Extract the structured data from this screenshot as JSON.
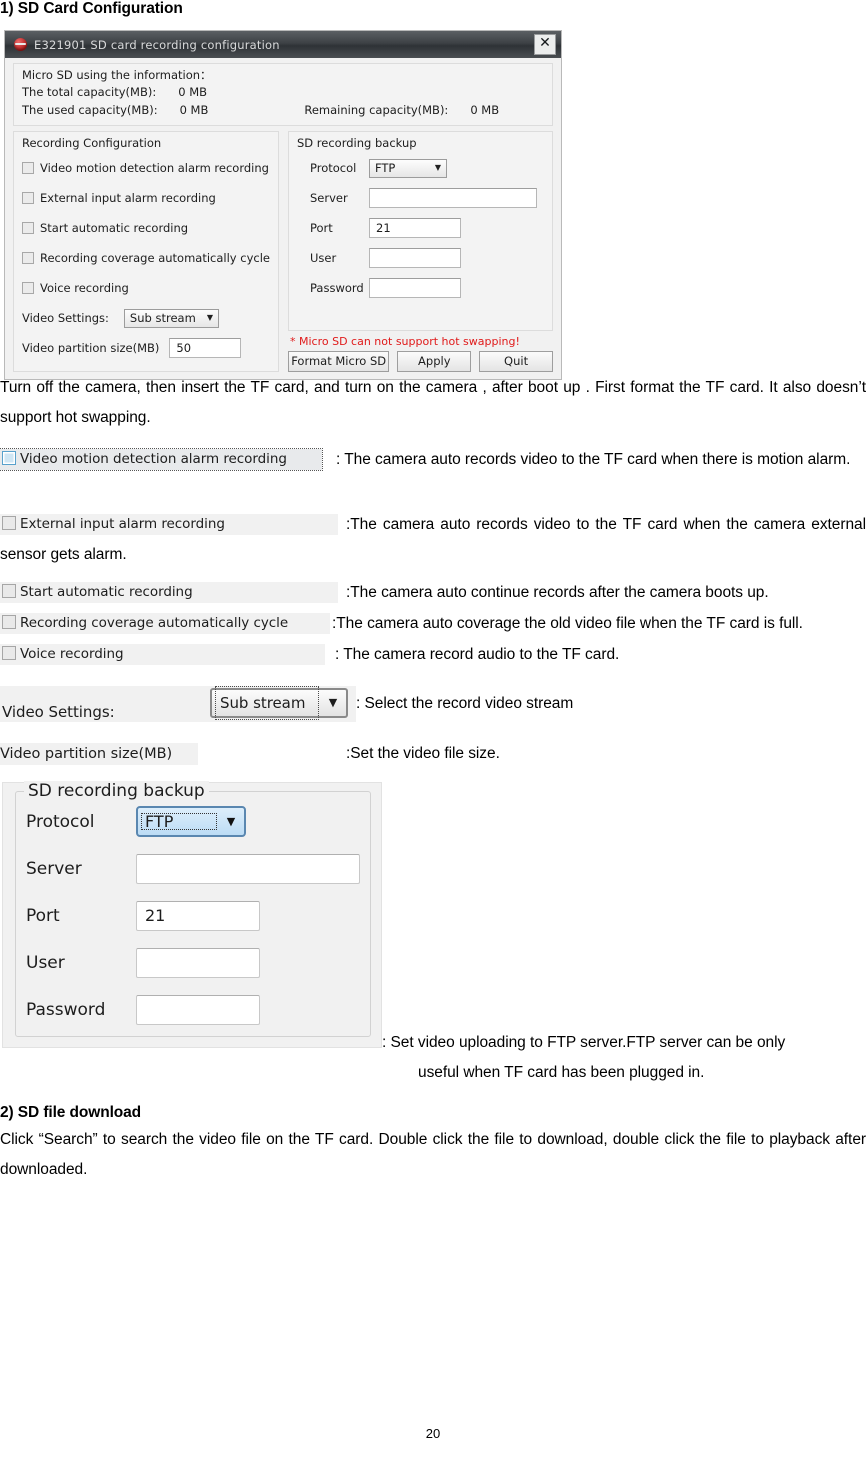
{
  "heading1": "1) SD Card Configuration",
  "dialog": {
    "title": "E321901 SD card recording configuration",
    "close_label": "✕",
    "logo_icon": "red-disc-icon",
    "info": {
      "header": "Micro SD using the information：",
      "total_label": "The total capacity(MB):",
      "total_value": "0 MB",
      "used_label": "The used capacity(MB):",
      "used_value": "0 MB",
      "remaining_label": "Remaining capacity(MB):",
      "remaining_value": "0 MB"
    },
    "recording_group": {
      "title": "Recording Configuration",
      "checkboxes": [
        {
          "label": "Video motion detection alarm recording",
          "checked": false
        },
        {
          "label": "External input alarm recording",
          "checked": false
        },
        {
          "label": "Start automatic recording",
          "checked": false
        },
        {
          "label": "Recording coverage automatically cycle",
          "checked": false
        },
        {
          "label": "Voice recording",
          "checked": false
        }
      ],
      "video_settings_label": "Video Settings:",
      "video_settings_value": "Sub stream",
      "partition_label": "Video partition size(MB)",
      "partition_value": "50"
    },
    "backup_group": {
      "title": "SD recording backup",
      "protocol_label": "Protocol",
      "protocol_value": "FTP",
      "server_label": "Server",
      "server_value": "",
      "port_label": "Port",
      "port_value": "21",
      "user_label": "User",
      "user_value": "",
      "password_label": "Password",
      "password_value": ""
    },
    "warning": "* Micro SD can not support hot swapping!",
    "buttons": {
      "format": "Format Micro SD",
      "apply": "Apply",
      "quit": "Quit"
    }
  },
  "intro_paragraph": "Turn off the camera, then insert the TF card, and turn on the camera , after boot up . First format the TF card. It also doesn’t support hot swapping.",
  "options": [
    {
      "widget_label": "Video motion detection alarm recording",
      "description": ": The camera auto records video to the TF card when there is motion alarm."
    },
    {
      "widget_label": "External input alarm recording",
      "description": ":The camera auto records video to the TF card when the camera external sensor gets alarm."
    },
    {
      "widget_label": "Start automatic recording",
      "description": ":The camera auto continue records after the camera boots up."
    },
    {
      "widget_label": "Recording coverage automatically cycle",
      "description": ":The camera auto coverage the old video file when the TF card is full."
    },
    {
      "widget_label": "Voice recording",
      "description": ": The camera record audio to the TF card."
    }
  ],
  "video_settings_snip": {
    "label": "Video Settings:",
    "value": "Sub stream",
    "arrow_icon": "chevron-down-icon",
    "description": ": Select the record video stream"
  },
  "video_partition_snip": {
    "label": "Video partition size(MB)",
    "description": ":Set the video file size."
  },
  "ftp_snip": {
    "group_title": "SD recording backup",
    "protocol_label": "Protocol",
    "protocol_value": "FTP",
    "arrow_icon": "chevron-down-icon",
    "server_label": "Server",
    "server_value": "",
    "port_label": "Port",
    "port_value": "21",
    "user_label": "User",
    "user_value": "",
    "password_label": "Password",
    "password_value": "",
    "description_line1": ": Set video uploading to FTP server.FTP server can be only",
    "description_line2": "useful when TF card has been plugged in."
  },
  "heading2": "2) SD file download",
  "download_paragraph": "Click “Search” to search the video file on the TF card. Double click the file to download, double click the file to playback after downloaded.",
  "page_number": "20",
  "colors": {
    "title_bar": "#3d4145",
    "warning_red": "#e01a1a",
    "focus_blue": "#5a87b0",
    "panel_bg": "#f1f1f1"
  }
}
